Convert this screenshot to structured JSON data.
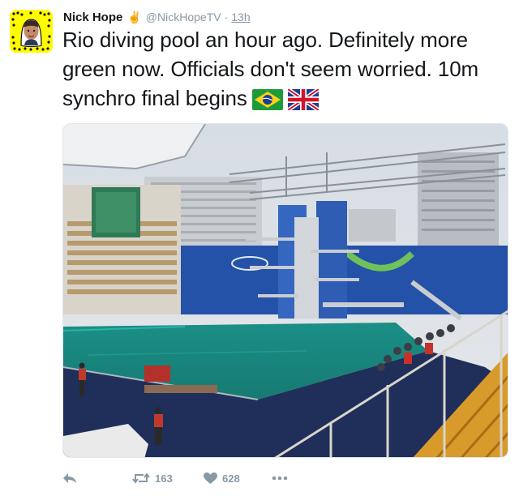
{
  "tweet": {
    "author_name": "Nick Hope",
    "badge_emoji": "✌",
    "handle": "@NickHopeTV",
    "separator": "·",
    "time": "13h",
    "text": "Rio diving pool an hour ago. Definitely more green now. Officials don't seem worried. 10m synchro final begins",
    "flags": [
      "brazil-flag-icon",
      "uk-flag-icon"
    ],
    "media_alt": "Rio diving pool with green water"
  },
  "actions": {
    "reply_icon": "reply-icon",
    "retweet_icon": "retweet-icon",
    "retweet_count": "163",
    "like_icon": "heart-icon",
    "like_count": "628",
    "more_icon": "more-icon"
  },
  "colors": {
    "text": "#14171a",
    "secondary": "#8899a6",
    "snapchat_yellow": "#fffc00",
    "pool_water": "#1a9a8e"
  }
}
